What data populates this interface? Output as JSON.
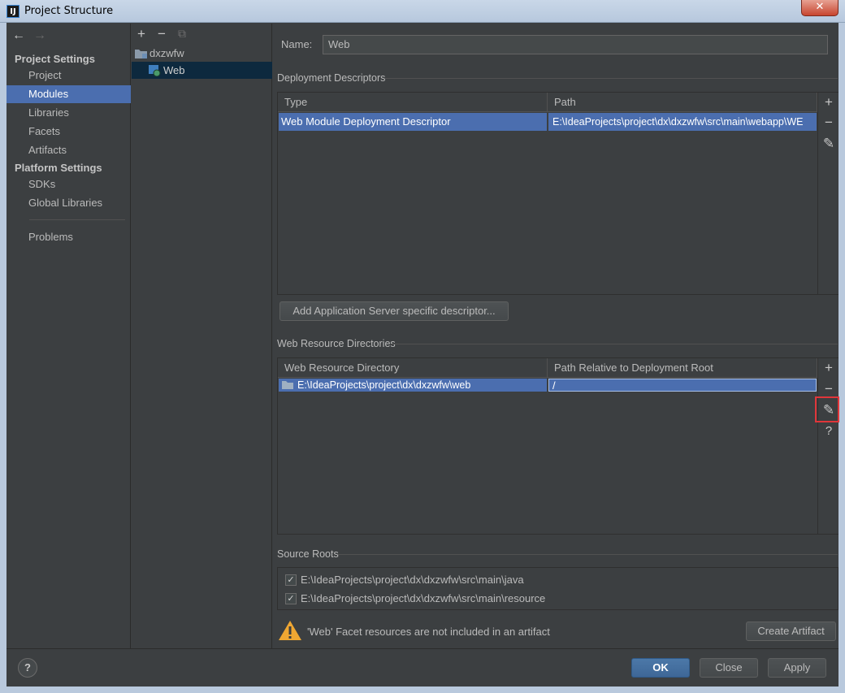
{
  "window": {
    "title": "Project Structure",
    "app_icon": "IJ",
    "close": "✕"
  },
  "sidebar": {
    "back": "←",
    "forward": "→",
    "project_settings": "Project Settings",
    "project_items": [
      "Project",
      "Modules",
      "Libraries",
      "Facets",
      "Artifacts"
    ],
    "platform_settings": "Platform Settings",
    "platform_items": [
      "SDKs",
      "Global Libraries"
    ],
    "problems": "Problems",
    "selected": "Modules"
  },
  "tree": {
    "add": "+",
    "remove": "−",
    "copy": "⧉",
    "nodes": [
      {
        "label": "dxzwfw",
        "icon": "folder-icon"
      },
      {
        "label": "Web",
        "icon": "web-module-icon"
      }
    ]
  },
  "main": {
    "name_label": "Name:",
    "name_value": "Web",
    "deployment_descriptors": {
      "title": "Deployment Descriptors",
      "columns": [
        "Type",
        "Path"
      ],
      "rows": [
        [
          "Web Module Deployment Descriptor",
          "E:\\IdeaProjects\\project\\dx\\dxzwfw\\src\\main\\webapp\\WE"
        ]
      ]
    },
    "add_descriptor_button": "Add Application Server specific descriptor...",
    "web_resource_dirs": {
      "title": "Web Resource Directories",
      "columns": [
        "Web Resource Directory",
        "Path Relative to Deployment Root"
      ],
      "rows": [
        [
          "E:\\IdeaProjects\\project\\dx\\dxzwfw\\web",
          "/"
        ]
      ]
    },
    "source_roots": {
      "title": "Source Roots",
      "items": [
        {
          "path": "E:\\IdeaProjects\\project\\dx\\dxzwfw\\src\\main\\java",
          "checked": true
        },
        {
          "path": "E:\\IdeaProjects\\project\\dx\\dxzwfw\\src\\main\\resource",
          "checked": true
        }
      ]
    },
    "warning": "'Web' Facet resources are not included in an artifact",
    "create_artifact_button": "Create Artifact"
  },
  "tools": {
    "add": "+",
    "remove": "−",
    "edit": "✎",
    "help": "?"
  },
  "footer": {
    "help": "?",
    "ok": "OK",
    "close": "Close",
    "apply": "Apply"
  },
  "colors": {
    "background": "#3c3f41",
    "selection": "#4b6eaf",
    "tree_selection": "#0d293e",
    "highlight": "#e0363a"
  }
}
